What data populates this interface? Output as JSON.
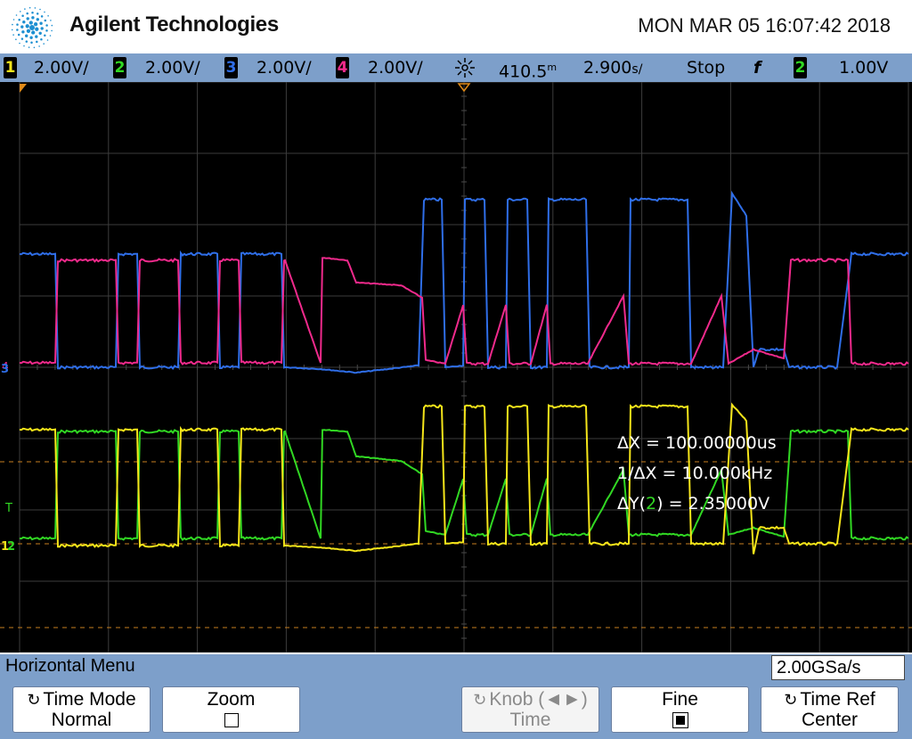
{
  "header": {
    "brand": "Agilent Technologies",
    "datetime": "MON MAR 05 16:07:42 2018"
  },
  "status": {
    "channels": [
      {
        "num": "1",
        "scale": "2.00V/",
        "color": "#f5e51a"
      },
      {
        "num": "2",
        "scale": "2.00V/",
        "color": "#31d823"
      },
      {
        "num": "3",
        "scale": "2.00V/",
        "color": "#2f6ee8"
      },
      {
        "num": "4",
        "scale": "2.00V/",
        "color": "#f02a8c"
      }
    ],
    "trigger_icon": "sun-icon",
    "delay": "410.5",
    "delay_unit": "m",
    "timebase": "2.900",
    "timebase_unit": "s/",
    "run_state": "Stop",
    "trigger_edge": "f",
    "trigger_source": "2",
    "trigger_level": "1.00V"
  },
  "measurements": {
    "dx": "ΔX = 100.00000us",
    "inv_dx": "1/ΔX = 10.000kHz",
    "dy_prefix": "ΔY(",
    "dy_channel": "2",
    "dy_suffix": ") = 2.35000V"
  },
  "markers": {
    "ch3": "3",
    "trigger": "T",
    "ch1": "1",
    "ch2": "2"
  },
  "menu": {
    "title": "Horizontal Menu",
    "sample_rate": "2.00GSa/s",
    "softkeys": [
      {
        "line1": "Time Mode",
        "line2": "Normal",
        "enabled": true
      },
      {
        "line1": "Zoom",
        "line2": "",
        "enabled": true,
        "checked": false
      },
      {
        "line1": "Knob (◄►)",
        "line2": "Time",
        "enabled": false
      },
      {
        "line1": "Fine",
        "line2": "",
        "enabled": true,
        "checked": true
      },
      {
        "line1": "Time Ref",
        "line2": "Center",
        "enabled": true
      }
    ]
  }
}
